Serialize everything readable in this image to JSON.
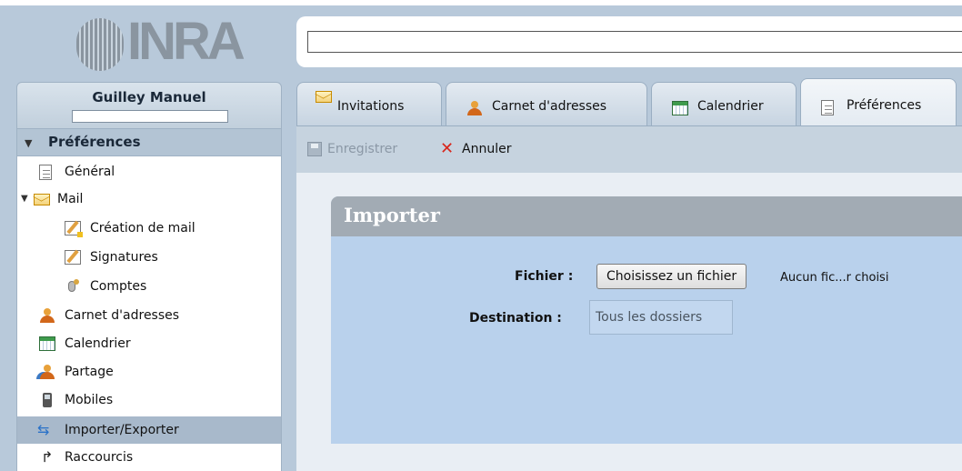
{
  "logo": {
    "text": "INRA"
  },
  "user": {
    "name": "Guilley Manuel"
  },
  "sidebar": {
    "section_title": "Préférences",
    "items": [
      {
        "label": "Général",
        "icon": "document-icon"
      },
      {
        "label": "Mail",
        "icon": "mail-icon"
      },
      {
        "label": "Création de mail",
        "icon": "compose-icon"
      },
      {
        "label": "Signatures",
        "icon": "signature-icon"
      },
      {
        "label": "Comptes",
        "icon": "accounts-icon"
      },
      {
        "label": "Carnet d'adresses",
        "icon": "address-book-icon"
      },
      {
        "label": "Calendrier",
        "icon": "calendar-icon"
      },
      {
        "label": "Partage",
        "icon": "share-icon"
      },
      {
        "label": "Mobiles",
        "icon": "mobile-icon"
      },
      {
        "label": "Importer/Exporter",
        "icon": "import-export-icon",
        "selected": true
      },
      {
        "label": "Raccourcis",
        "icon": "shortcut-icon"
      }
    ]
  },
  "search": {
    "value": ""
  },
  "tabs": [
    {
      "label": "Invitations",
      "icon": "mail-icon"
    },
    {
      "label": "Carnet d'adresses",
      "icon": "address-book-icon"
    },
    {
      "label": "Calendrier",
      "icon": "calendar-icon"
    },
    {
      "label": "Préférences",
      "icon": "document-icon",
      "active": true
    }
  ],
  "toolbar": {
    "save_label": "Enregistrer",
    "cancel_label": "Annuler"
  },
  "import_panel": {
    "title": "Importer",
    "file_label": "Fichier :",
    "file_button": "Choisissez un fichier",
    "file_status": "Aucun fic...r choisi",
    "destination_label": "Destination :",
    "destination_value": "Tous les dossiers"
  },
  "colors": {
    "background": "#b8c9da",
    "selected_item": "#a8b9cb",
    "panel": "#b9d1ec",
    "panel_header": "#a2abb4"
  }
}
